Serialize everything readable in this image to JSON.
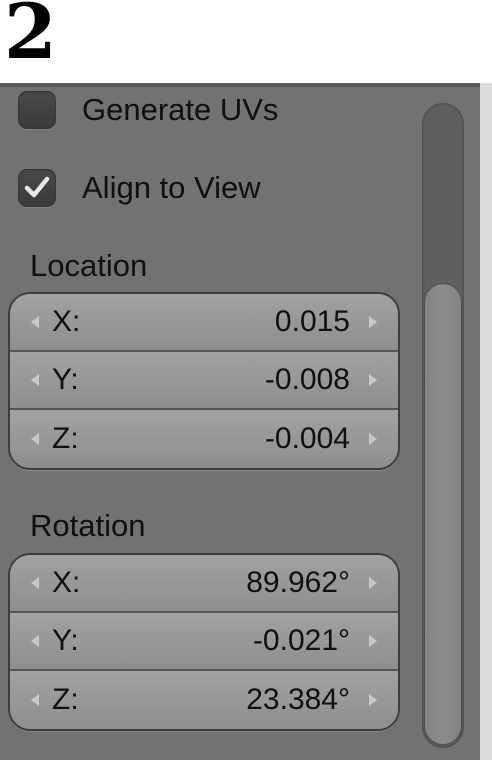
{
  "step": {
    "number": "2"
  },
  "options": {
    "generate_uvs": {
      "label": "Generate UVs",
      "checked": false
    },
    "align_to_view": {
      "label": "Align to View",
      "checked": true
    }
  },
  "location": {
    "label": "Location",
    "fields": [
      {
        "axis": "X:",
        "value": "0.015"
      },
      {
        "axis": "Y:",
        "value": "-0.008"
      },
      {
        "axis": "Z:",
        "value": "-0.004"
      }
    ]
  },
  "rotation": {
    "label": "Rotation",
    "fields": [
      {
        "axis": "X:",
        "value": "89.962°"
      },
      {
        "axis": "Y:",
        "value": "-0.021°"
      },
      {
        "axis": "Z:",
        "value": "23.384°"
      }
    ]
  },
  "icons": {
    "checkmark": "checkmark-icon",
    "decrement": "triangle-left-icon",
    "increment": "triangle-right-icon"
  },
  "colors": {
    "panel_bg": "#727272",
    "field_bg": "#9a9a9a",
    "text": "#101010"
  }
}
